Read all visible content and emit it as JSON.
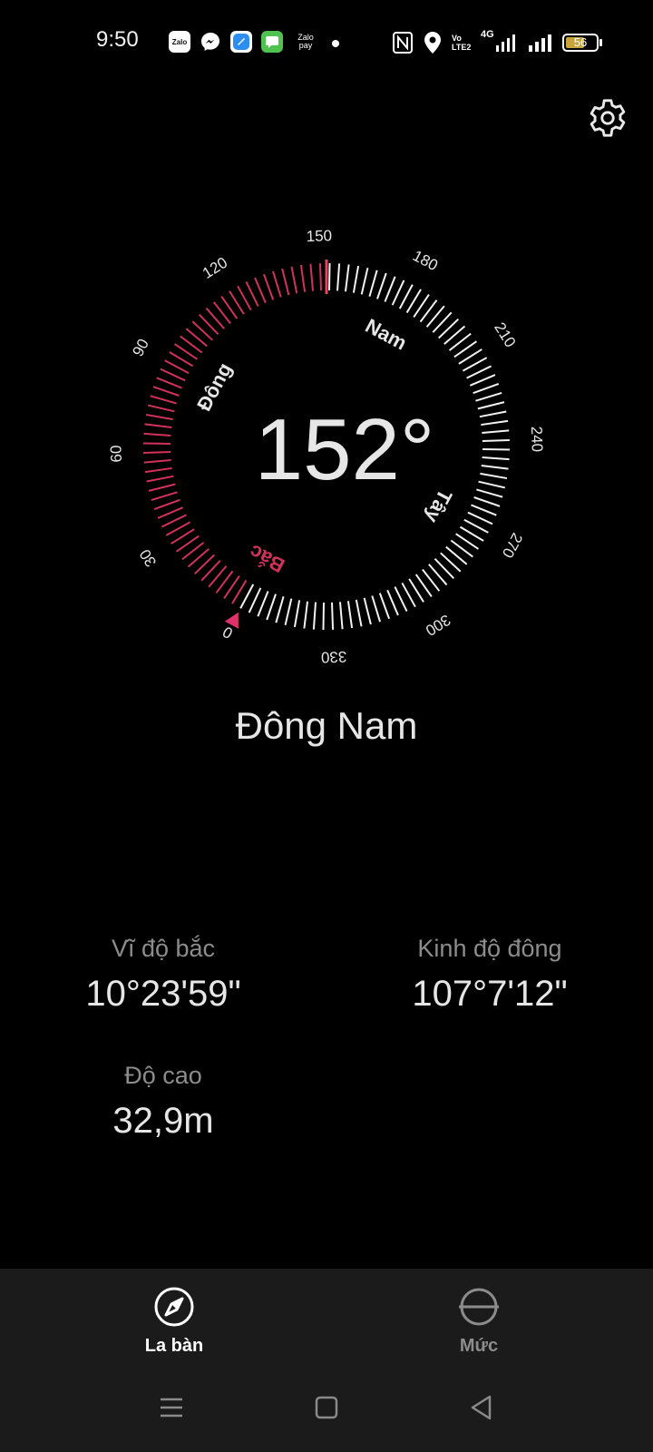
{
  "status_bar": {
    "time": "9:50",
    "notifications": [
      "zalo-icon",
      "messenger-icon",
      "files-icon",
      "messages-icon",
      "zalopay-icon"
    ],
    "zalo_text": "Zalo",
    "zalopay_text": "Zalo pay",
    "volte_text": "Vo LTE2",
    "network_text": "4G",
    "battery_level": "56"
  },
  "compass": {
    "heading": "152°",
    "direction_name": "Đông Nam",
    "tick_labels": [
      "0",
      "30",
      "60",
      "90",
      "120",
      "150",
      "180",
      "210",
      "240",
      "270",
      "300",
      "330"
    ],
    "cardinals": {
      "north": "Bắc",
      "east": "Đông",
      "south": "Nam",
      "west": "Tây"
    },
    "accent_color": "#d2325a",
    "heading_value": 152
  },
  "info": {
    "latitude_label": "Vĩ độ bắc",
    "latitude_value": "10°23'59\"",
    "longitude_label": "Kinh độ đông",
    "longitude_value": "107°7'12\"",
    "altitude_label": "Độ cao",
    "altitude_value": "32,9m"
  },
  "tabs": [
    {
      "label": "La bàn",
      "icon": "compass-icon",
      "active": true
    },
    {
      "label": "Mức",
      "icon": "level-icon",
      "active": false
    }
  ],
  "colors": {
    "background": "#000000",
    "tabbar": "#1b1b1b",
    "accent": "#d2325a",
    "inactive": "#8c8c8c"
  }
}
